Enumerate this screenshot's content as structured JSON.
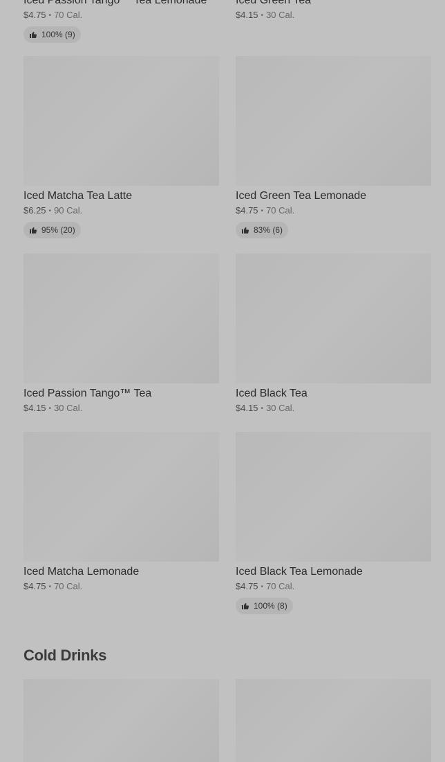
{
  "top_partial": [
    {
      "name": "Iced Passion Tango™ Tea Lemonade",
      "price": "$4.75",
      "cal": "70 Cal.",
      "rating": "100% (9)"
    },
    {
      "name": "Iced Green Tea",
      "price": "$4.15",
      "cal": "30 Cal.",
      "rating": null
    }
  ],
  "items": [
    {
      "name": "Iced Matcha Tea Latte",
      "price": "$6.25",
      "cal": "90 Cal.",
      "rating": "95% (20)"
    },
    {
      "name": "Iced Green Tea Lemonade",
      "price": "$4.75",
      "cal": "70 Cal.",
      "rating": "83% (6)"
    },
    {
      "name": "Iced Passion Tango™ Tea",
      "price": "$4.15",
      "cal": "30 Cal.",
      "rating": null
    },
    {
      "name": "Iced Black Tea",
      "price": "$4.15",
      "cal": "30 Cal.",
      "rating": null
    },
    {
      "name": "Iced Matcha Lemonade",
      "price": "$4.75",
      "cal": "70 Cal.",
      "rating": null
    },
    {
      "name": "Iced Black Tea Lemonade",
      "price": "$4.75",
      "cal": "70 Cal.",
      "rating": "100% (8)"
    }
  ],
  "section": {
    "title": "Cold Drinks"
  },
  "separator": "•"
}
